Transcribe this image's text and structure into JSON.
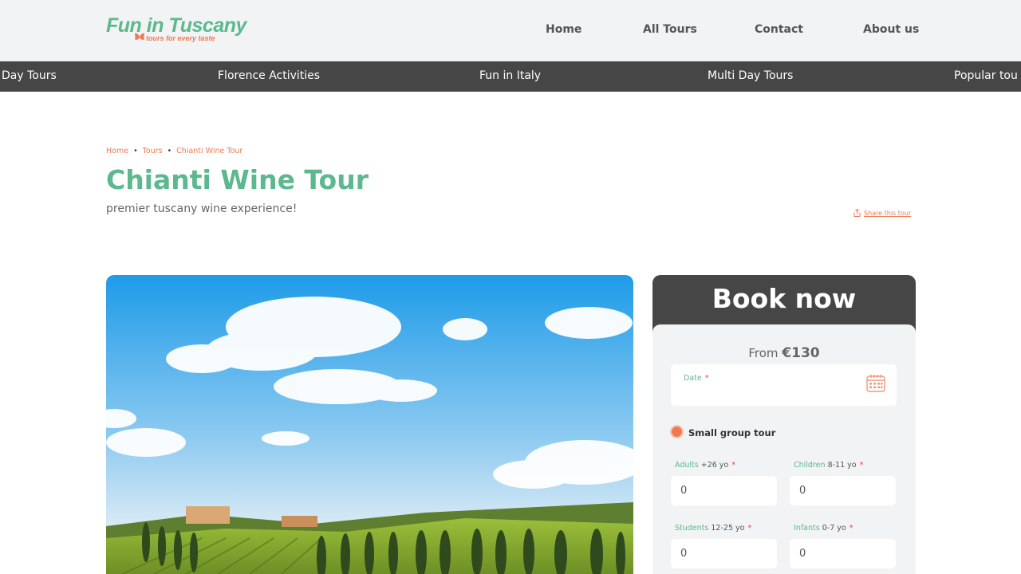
{
  "header": {
    "logo_main": "Fun in Tuscany",
    "logo_tagline": "tours for every taste",
    "nav": [
      "Home",
      "All Tours",
      "Contact",
      "About us"
    ]
  },
  "categories": [
    "Day Tours",
    "Florence Activities",
    "Fun in Italy",
    "Multi Day Tours",
    "Popular tou"
  ],
  "breadcrumb": [
    "Home",
    "Tours",
    "Chianti Wine Tour"
  ],
  "tour": {
    "title": "Chianti Wine Tour",
    "subtitle": "premier tuscany wine experience!",
    "share": "Share this tour"
  },
  "booking": {
    "title": "Book now",
    "from_label": "From",
    "price": "€130",
    "date_label": "Date",
    "tour_type": "Small group tour",
    "fields": [
      {
        "label": "Adults",
        "range": "+26 yo",
        "value": "0"
      },
      {
        "label": "Children",
        "range": "8-11 yo",
        "value": "0"
      },
      {
        "label": "Students",
        "range": "12-25 yo",
        "value": "0"
      },
      {
        "label": "Infants",
        "range": "0-7 yo",
        "value": "0"
      }
    ],
    "required_mark": "*"
  },
  "colors": {
    "brand_green": "#5cb88d",
    "accent_orange": "#ef7a52",
    "dark_bar": "#464646",
    "light_bg": "#f1f3f5"
  }
}
